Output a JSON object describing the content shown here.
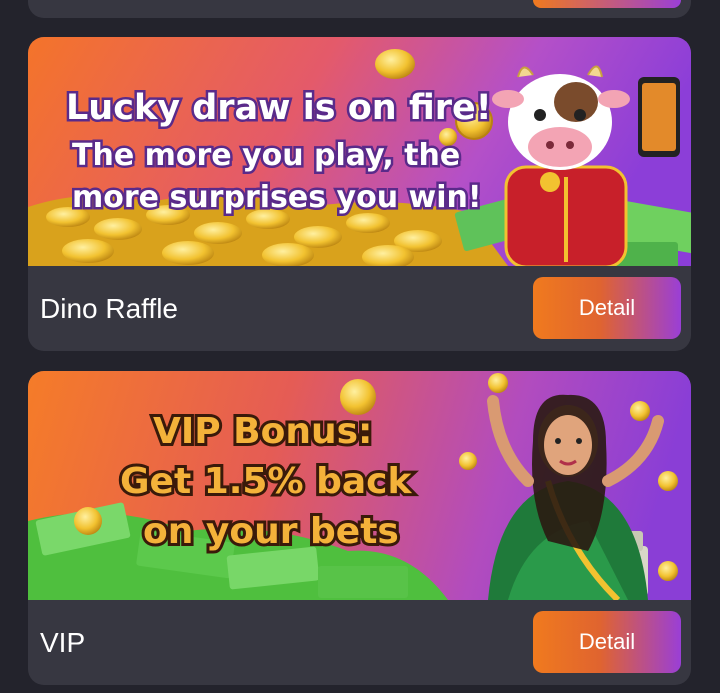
{
  "promotions": [
    {
      "title": "Dino Raffle",
      "detail_label": "Detail",
      "banner": {
        "line1": "Lucky draw is on fire!",
        "line2": "The more you play, the",
        "line3": "more surprises you win!"
      }
    },
    {
      "title": "VIP",
      "detail_label": "Detail",
      "banner": {
        "line1": "VIP Bonus:",
        "line2": "Get 1.5% back",
        "line3": "on your bets"
      }
    }
  ]
}
